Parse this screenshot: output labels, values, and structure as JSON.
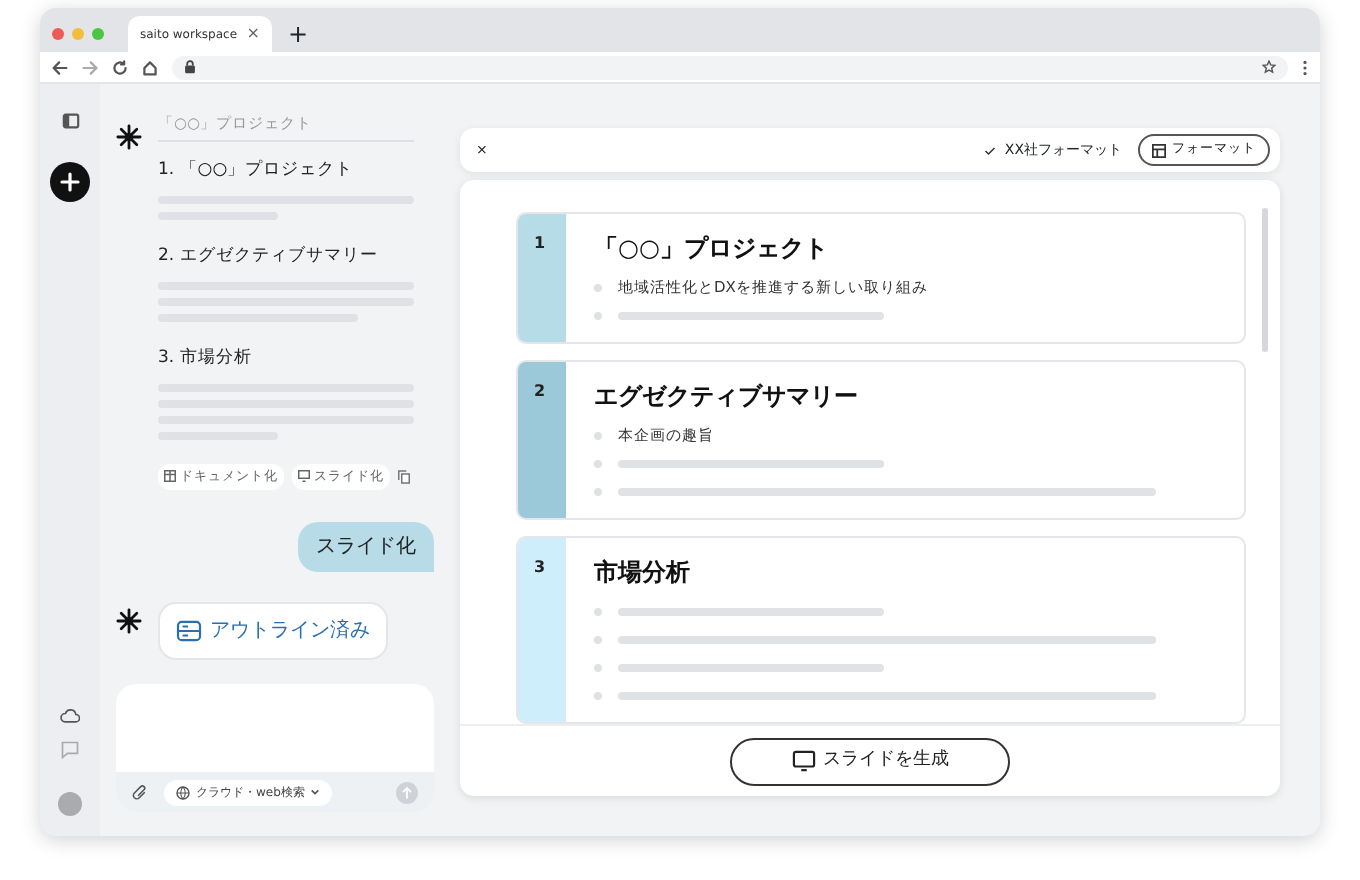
{
  "browser": {
    "tab_title": "saito workspace",
    "tab_close": "×",
    "new_tab": "+"
  },
  "chat": {
    "outline": {
      "heading": "「○○」プロジェクト",
      "sections": [
        {
          "title": "1. 「○○」プロジェクト",
          "bars": [
            {
              "kind": "full"
            },
            {
              "kind": "short"
            }
          ]
        },
        {
          "title": "2. エグゼクティブサマリー",
          "bars": [
            {
              "kind": "full"
            },
            {
              "kind": "full"
            },
            {
              "kind": "medium"
            }
          ]
        },
        {
          "title": "3. 市場分析",
          "bars": [
            {
              "kind": "full"
            },
            {
              "kind": "full"
            },
            {
              "kind": "full"
            },
            {
              "kind": "short"
            }
          ]
        }
      ],
      "actions": [
        {
          "kind": "document",
          "label": "ドキュメント化"
        },
        {
          "kind": "slide",
          "label": "スライド化"
        }
      ]
    },
    "user_message": "スライド化",
    "status_chip": "アウトライン済み",
    "input": {
      "tool_chip": "クラウド・web検索"
    }
  },
  "panel": {
    "close": "×",
    "selected_format": "XX社フォーマット",
    "format_button": "フォーマット",
    "slides": [
      {
        "number": "1",
        "title": "「○○」プロジェクト",
        "color": "#b6dce7",
        "bullets": [
          {
            "kind": "text",
            "text": "地域活性化とDXを推進する新しい取り組み"
          },
          {
            "kind": "short_bar"
          }
        ]
      },
      {
        "number": "2",
        "title": "エグゼクティブサマリー",
        "color": "#9cc9d9",
        "bullets": [
          {
            "kind": "text",
            "text": "本企画の趣旨"
          },
          {
            "kind": "short_bar"
          },
          {
            "kind": "long_bar"
          }
        ]
      },
      {
        "number": "3",
        "title": "市場分析",
        "color": "#cdeefa",
        "bullets": [
          {
            "kind": "short_bar"
          },
          {
            "kind": "long_bar"
          },
          {
            "kind": "short_bar"
          },
          {
            "kind": "long_bar"
          }
        ]
      }
    ],
    "generate_button": "スライドを生成"
  }
}
